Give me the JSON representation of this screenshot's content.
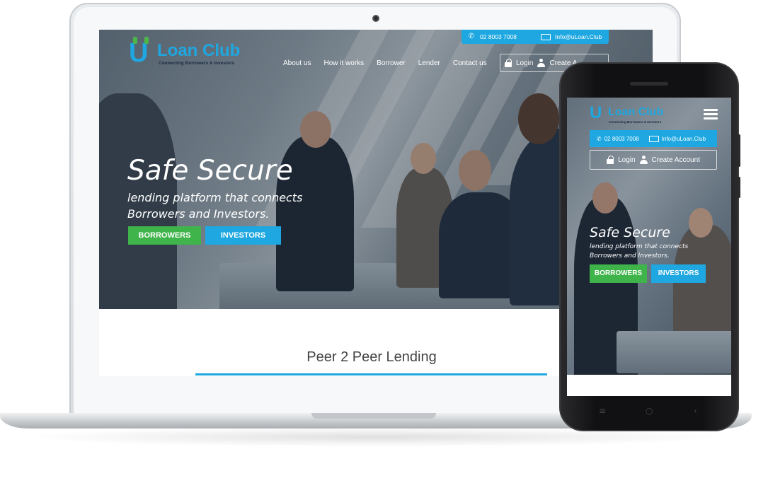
{
  "colors": {
    "accent_blue": "#1ea7e0",
    "accent_green": "#3fb44a",
    "logo_tagline": "#1d2b44",
    "heading_gray": "#444444"
  },
  "brand": {
    "name": "Loan Club",
    "logo_letter": "U",
    "tagline": "Connecting Borrowers & Investors"
  },
  "contact": {
    "phone": "02 8003 7008",
    "email": "Info@uLoan.Club",
    "phone_icon": "phone-icon",
    "email_icon": "envelope-icon"
  },
  "nav": {
    "items": [
      "About us",
      "How it works",
      "Borrower",
      "Lender",
      "Contact us"
    ]
  },
  "account": {
    "login_label": "Login",
    "create_label": "Create Account",
    "laptop_create_label": "Create A"
  },
  "hero": {
    "headline": "Safe Secure",
    "subline": "lending platform that connects Borrowers and Investors.",
    "borrowers_button": "BORROWERS",
    "investors_button": "INVESTORS"
  },
  "section": {
    "title": "Peer 2 Peer Lending"
  },
  "phone_nav": {
    "menu_icon": "hamburger-menu-icon",
    "soft_keys": [
      "≡",
      "○",
      "‹"
    ]
  }
}
